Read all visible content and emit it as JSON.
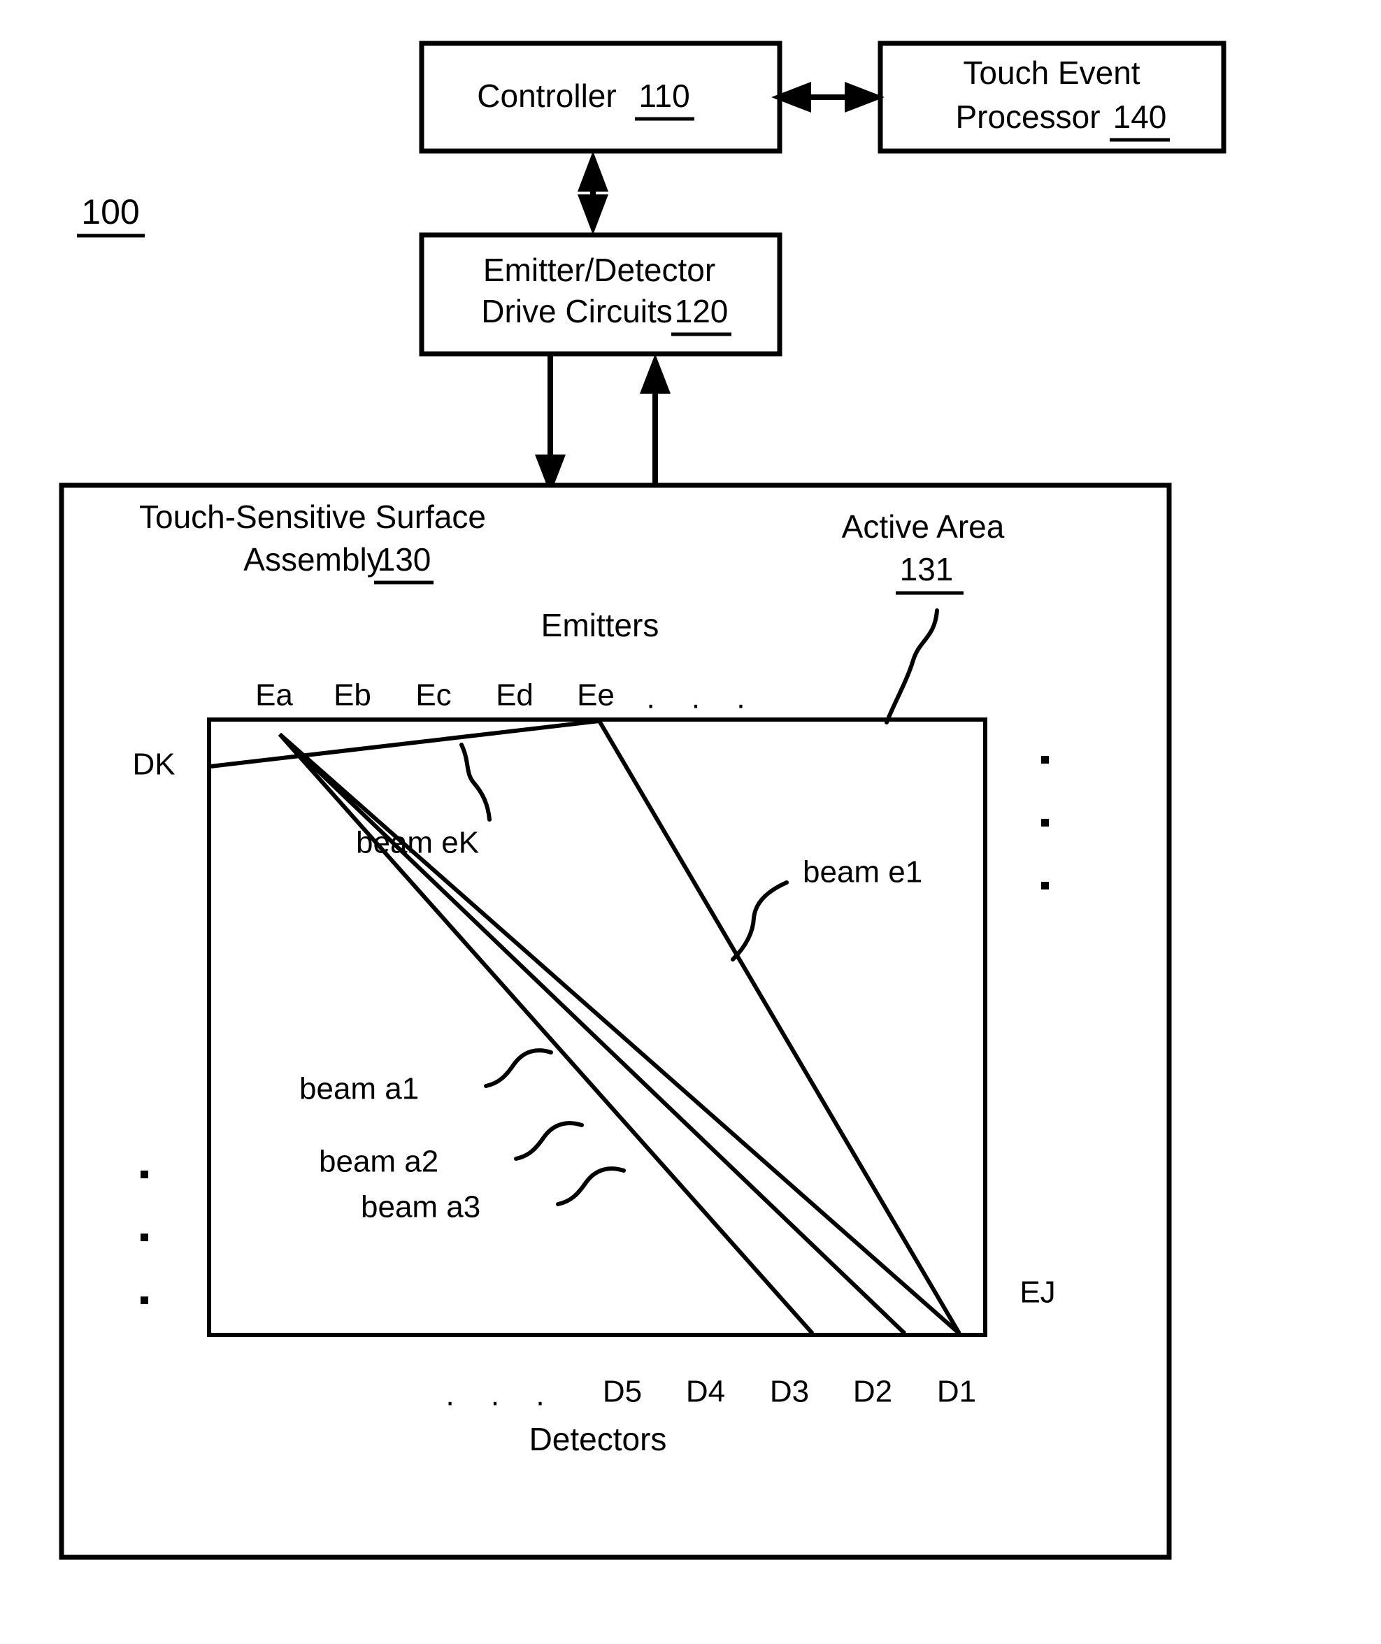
{
  "figure": {
    "ref_numeral": "100"
  },
  "blocks": {
    "controller": {
      "label": "Controller",
      "ref": "110"
    },
    "touch_event_processor": {
      "label_line1": "Touch Event",
      "label_line2": "Processor",
      "ref": "140"
    },
    "drive_circuits": {
      "label_line1": "Emitter/Detector",
      "label_line2": "Drive Circuits",
      "ref": "120"
    },
    "assembly": {
      "label_line1": "Touch-Sensitive Surface",
      "label_line2": "Assembly",
      "ref": "130"
    },
    "active_area": {
      "label": "Active Area",
      "ref": "131"
    }
  },
  "axes": {
    "emitters_title": "Emitters",
    "detectors_title": "Detectors",
    "emitter_labels": [
      "Ea",
      "Eb",
      "Ec",
      "Ed",
      "Ee"
    ],
    "emitter_ellipsis": ". . .",
    "detector_labels": [
      "D5",
      "D4",
      "D3",
      "D2",
      "D1"
    ],
    "detector_ellipsis": ". . .",
    "left_port": "DK",
    "right_port": "EJ"
  },
  "beams": [
    {
      "id": "beam-ek",
      "label": "beam eK"
    },
    {
      "id": "beam-e1",
      "label": "beam e1"
    },
    {
      "id": "beam-a1",
      "label": "beam a1"
    },
    {
      "id": "beam-a2",
      "label": "beam a2"
    },
    {
      "id": "beam-a3",
      "label": "beam a3"
    }
  ],
  "colors": {
    "stroke": "#000000",
    "background": "#ffffff"
  }
}
